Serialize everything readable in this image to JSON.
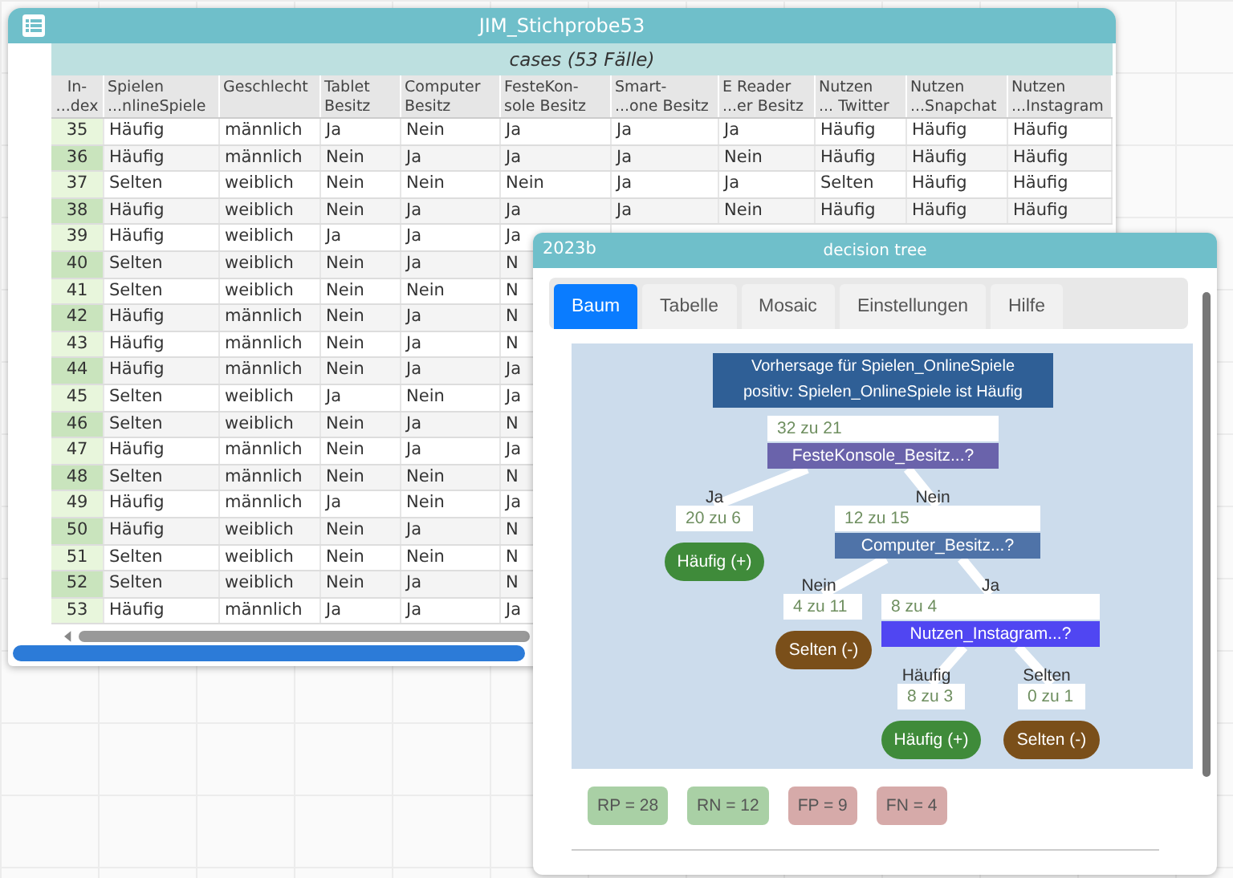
{
  "table_window": {
    "title": "JIM_Stichprobe53",
    "subtitle": "cases (53 Fälle)",
    "columns": [
      "In-\n...dex",
      "Spielen\n...nlineSpiele",
      "Geschlecht",
      "Tablet\nBesitz",
      "Computer\nBesitz",
      "FesteKon-\nsole Besitz",
      "Smart-\n...one Besitz",
      "E Reader\n...er Besitz",
      "Nutzen\n... Twitter",
      "Nutzen\n...Snapchat",
      "Nutzen\n...Instagram"
    ],
    "rows": [
      [
        "35",
        "Häufig",
        "männlich",
        "Ja",
        "Nein",
        "Ja",
        "Ja",
        "Ja",
        "Häufig",
        "Häufig",
        "Häufig"
      ],
      [
        "36",
        "Häufig",
        "männlich",
        "Nein",
        "Ja",
        "Ja",
        "Ja",
        "Nein",
        "Häufig",
        "Häufig",
        "Häufig"
      ],
      [
        "37",
        "Selten",
        "weiblich",
        "Nein",
        "Nein",
        "Nein",
        "Ja",
        "Ja",
        "Selten",
        "Häufig",
        "Häufig"
      ],
      [
        "38",
        "Häufig",
        "weiblich",
        "Nein",
        "Ja",
        "Ja",
        "Ja",
        "Nein",
        "Häufig",
        "Häufig",
        "Häufig"
      ],
      [
        "39",
        "Häufig",
        "weiblich",
        "Ja",
        "Ja",
        "Ja"
      ],
      [
        "40",
        "Selten",
        "weiblich",
        "Nein",
        "Ja",
        "N"
      ],
      [
        "41",
        "Selten",
        "weiblich",
        "Nein",
        "Nein",
        "N"
      ],
      [
        "42",
        "Häufig",
        "männlich",
        "Nein",
        "Ja",
        "N"
      ],
      [
        "43",
        "Häufig",
        "männlich",
        "Nein",
        "Ja",
        "N"
      ],
      [
        "44",
        "Häufig",
        "männlich",
        "Nein",
        "Ja",
        "Ja"
      ],
      [
        "45",
        "Selten",
        "weiblich",
        "Ja",
        "Nein",
        "Ja"
      ],
      [
        "46",
        "Selten",
        "weiblich",
        "Nein",
        "Ja",
        "N"
      ],
      [
        "47",
        "Häufig",
        "männlich",
        "Nein",
        "Ja",
        "Ja"
      ],
      [
        "48",
        "Selten",
        "männlich",
        "Nein",
        "Nein",
        "N"
      ],
      [
        "49",
        "Häufig",
        "männlich",
        "Ja",
        "Nein",
        "Ja"
      ],
      [
        "50",
        "Häufig",
        "weiblich",
        "Nein",
        "Ja",
        "N"
      ],
      [
        "51",
        "Selten",
        "weiblich",
        "Nein",
        "Nein",
        "N"
      ],
      [
        "52",
        "Selten",
        "weiblich",
        "Nein",
        "Ja",
        "N"
      ],
      [
        "53",
        "Häufig",
        "männlich",
        "Ja",
        "Ja",
        "Ja"
      ]
    ]
  },
  "tree_window": {
    "label": "2023b",
    "title": "decision tree",
    "tabs": [
      {
        "label": "Baum",
        "selected": true
      },
      {
        "label": "Tabelle",
        "selected": false
      },
      {
        "label": "Mosaic",
        "selected": false
      },
      {
        "label": "Einstellungen",
        "selected": false
      },
      {
        "label": "Hilfe",
        "selected": false
      }
    ],
    "header": [
      "Vorhersage für Spielen_OnlineSpiele",
      "positiv: Spielen_OnlineSpiele ist Häufig"
    ],
    "root": {
      "kind": "split",
      "count": "32 zu 21",
      "question": "FesteKonsole_Besitz...?",
      "color": "#6a63ab",
      "children": [
        {
          "kind": "leaf",
          "branch": "Ja",
          "count": "20 zu 6",
          "label": "Häufig (+)",
          "color": "#3f8b3a"
        },
        {
          "kind": "split",
          "branch": "Nein",
          "count": "12 zu 15",
          "question": "Computer_Besitz...?",
          "color": "#4f73a8",
          "children": [
            {
              "kind": "leaf",
              "branch": "Nein",
              "count": "4 zu 11",
              "label": "Selten (-)",
              "color": "#7a4f1a"
            },
            {
              "kind": "split",
              "branch": "Ja",
              "count": "8 zu 4",
              "question": "Nutzen_Instagram...?",
              "color": "#5046f2",
              "children": [
                {
                  "kind": "leaf",
                  "branch": "Häufig",
                  "count": "8 zu 3",
                  "label": "Häufig (+)",
                  "color": "#3f8b3a"
                },
                {
                  "kind": "leaf",
                  "branch": "Selten",
                  "count": "0 zu 1",
                  "label": "Selten (-)",
                  "color": "#7a4f1a"
                }
              ]
            }
          ]
        }
      ]
    },
    "metrics": [
      {
        "label": "RP = 28",
        "color": "#a9d0a5"
      },
      {
        "label": "RN = 12",
        "color": "#a9d0a5"
      },
      {
        "label": "FP = 9",
        "color": "#d6aaa9"
      },
      {
        "label": "FN = 4",
        "color": "#d6aaa9"
      }
    ]
  }
}
